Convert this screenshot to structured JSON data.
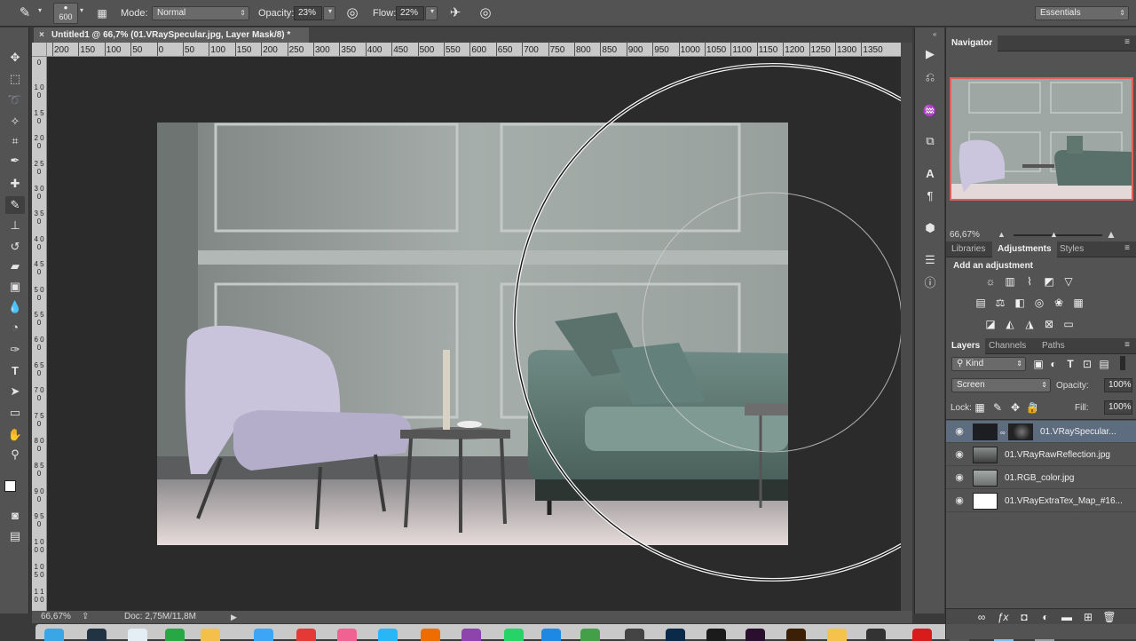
{
  "options_bar": {
    "brush_size": "600",
    "mode_label": "Mode:",
    "mode_value": "Normal",
    "opacity_label": "Opacity:",
    "opacity_value": "23%",
    "flow_label": "Flow:",
    "flow_value": "22%",
    "workspace": "Essentials"
  },
  "document": {
    "tab_title": "Untitled1 @ 66,7% (01.VRaySpecular.jpg, Layer Mask/8) *",
    "close_glyph": "×",
    "zoom": "66,67%",
    "doc_size": "Doc: 2,75M/11,8M"
  },
  "rulers": {
    "horizontal": [
      "200",
      "150",
      "100",
      "50",
      "0",
      "50",
      "100",
      "150",
      "200",
      "250",
      "300",
      "350",
      "400",
      "450",
      "500",
      "550",
      "600",
      "650",
      "700",
      "750",
      "800",
      "850",
      "900",
      "950",
      "1000",
      "1050",
      "1100",
      "1150",
      "1200",
      "1250",
      "1300",
      "1350"
    ],
    "vertical": [
      "0",
      "1 0 0",
      "1 5 0",
      "2 0 0",
      "2 5 0",
      "3 0 0",
      "3 5 0",
      "4 0 0",
      "4 5 0",
      "5 0 0",
      "5 5 0",
      "6 0 0",
      "6 5 0",
      "7 0 0",
      "7 5 0",
      "8 0 0",
      "8 5 0",
      "9 0 0",
      "9 5 0",
      "1 0 0 0",
      "1 0 5 0",
      "1 1 0 0"
    ]
  },
  "navigator": {
    "title": "Navigator",
    "zoom": "66,67%"
  },
  "adjustments": {
    "tabs": [
      "Libraries",
      "Adjustments",
      "Styles"
    ],
    "active_tab": "Adjustments",
    "heading": "Add an adjustment"
  },
  "layers_panel": {
    "tabs": [
      "Layers",
      "Channels",
      "Paths"
    ],
    "kind_filter": "Kind",
    "blend_mode": "Screen",
    "opacity_label": "Opacity:",
    "opacity_value": "100%",
    "lock_label": "Lock:",
    "fill_label": "Fill:",
    "fill_value": "100%",
    "layers": [
      {
        "name": "01.VRaySpecular...",
        "selected": true
      },
      {
        "name": "01.VRayRawReflection.jpg",
        "selected": false
      },
      {
        "name": "01.RGB_color.jpg",
        "selected": false
      },
      {
        "name": "01.VRayExtraTex_Map_#16...",
        "selected": false
      }
    ]
  },
  "colors": {
    "panel": "#535353",
    "canvas_bg": "#2b2b2b",
    "selection": "#5e6c80",
    "navigator_frame": "#e0605a"
  }
}
